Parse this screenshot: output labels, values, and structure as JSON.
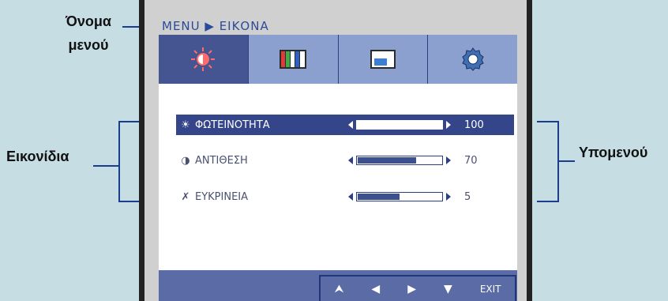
{
  "callouts": {
    "menu_name_line1": "Όνομα",
    "menu_name_line2": "μενού",
    "icons": "Εικονίδια",
    "submenu": "Υπομενού"
  },
  "osd": {
    "title": "MENU ▶ ΕΙΚΟΝΑ",
    "tabs": [
      {
        "name": "picture",
        "icon": "brightness-icon",
        "active": true
      },
      {
        "name": "color",
        "icon": "color-bars-icon",
        "active": false
      },
      {
        "name": "display",
        "icon": "monitor-icon",
        "active": false
      },
      {
        "name": "setup",
        "icon": "gear-icon",
        "active": false
      }
    ],
    "items": [
      {
        "icon": "sun-icon",
        "icon_glyph": "☀",
        "label": "ΦΩΤΕΙΝΟΤΗΤΑ",
        "value": "100",
        "level": 1.0,
        "selected": true
      },
      {
        "icon": "contrast-icon",
        "icon_glyph": "◑",
        "label": "ΑΝΤΙΘΕΣΗ",
        "value": "70",
        "level": 0.7,
        "selected": false
      },
      {
        "icon": "sharpness-icon",
        "icon_glyph": "✗",
        "label": "ΕΥΚΡΙΝΕΙΑ",
        "value": "5",
        "level": 0.5,
        "selected": false
      }
    ],
    "nav": {
      "up": "⮝",
      "left": "◀",
      "right": "▶",
      "down": "▼",
      "exit": "EXIT"
    }
  },
  "colors": {
    "background": "#c5dde3",
    "accent": "#34458a",
    "callout_line": "#1a3d8c"
  }
}
